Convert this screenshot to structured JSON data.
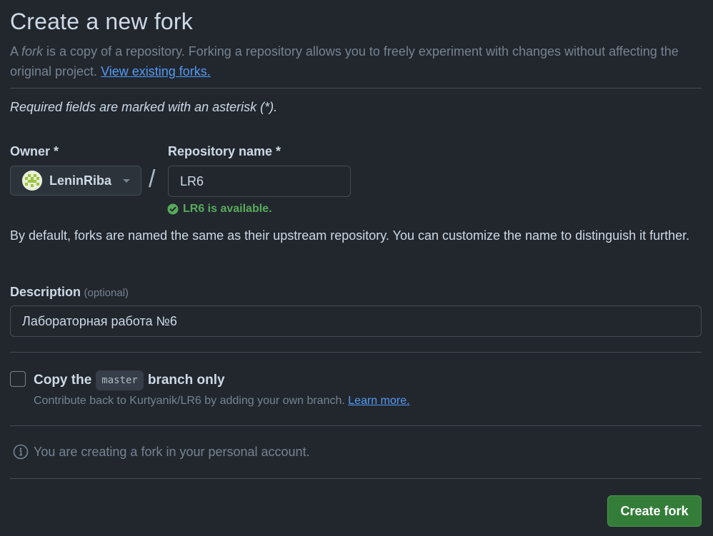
{
  "header": {
    "title": "Create a new fork",
    "intro_prefix": "A ",
    "intro_fork_word": "fork",
    "intro_text": " is a copy of a repository. Forking a repository allows you to freely experiment with changes without affecting the original project.",
    "view_forks_link": "View existing forks."
  },
  "required_note": "Required fields are marked with an asterisk (*).",
  "owner": {
    "label": "Owner *",
    "selected": "LeninRiba"
  },
  "repo": {
    "label": "Repository name *",
    "value": "LR6",
    "availability": "LR6 is available.",
    "availability_color": "#57ab5a"
  },
  "default_note": "By default, forks are named the same as their upstream repository. You can customize the name to distinguish it further.",
  "description": {
    "label": "Description",
    "optional": "(optional)",
    "value": "Лабораторная работа №6"
  },
  "copy_branch": {
    "checked": false,
    "prefix": "Copy the",
    "branch": "master",
    "suffix": "branch only",
    "contribute_text": "Contribute back to Kurtyanik/LR6 by adding your own branch.",
    "learn_more": "Learn more."
  },
  "info_note": "You are creating a fork in your personal account.",
  "submit": {
    "label": "Create fork",
    "color": "#347d39"
  }
}
